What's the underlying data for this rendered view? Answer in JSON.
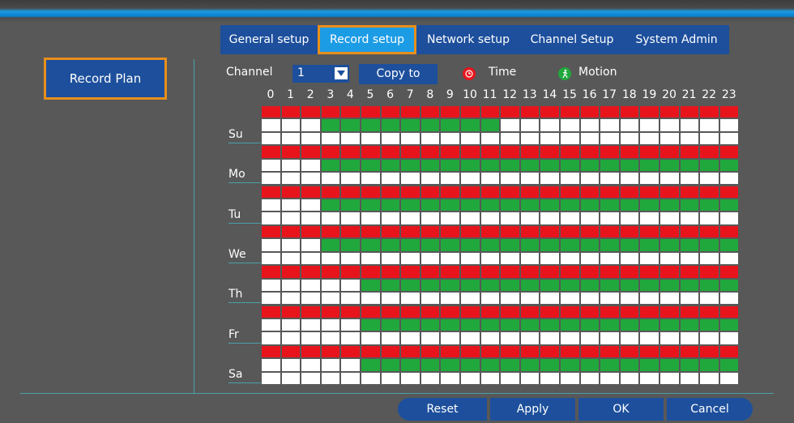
{
  "tabs": [
    {
      "label": "General setup",
      "active": false
    },
    {
      "label": "Record setup",
      "active": true
    },
    {
      "label": "Network setup",
      "active": false
    },
    {
      "label": "Channel Setup",
      "active": false
    },
    {
      "label": "System Admin",
      "active": false
    }
  ],
  "sidebar": {
    "record_plan_label": "Record Plan"
  },
  "toolbar": {
    "channel_label": "Channel",
    "channel_value": "1",
    "copy_label": "Copy to",
    "time_label": "Time",
    "motion_label": "Motion"
  },
  "hours": [
    "0",
    "1",
    "2",
    "3",
    "4",
    "5",
    "6",
    "7",
    "8",
    "9",
    "10",
    "11",
    "12",
    "13",
    "14",
    "15",
    "16",
    "17",
    "18",
    "19",
    "20",
    "21",
    "22",
    "23"
  ],
  "schedule": [
    {
      "day": "Su",
      "time": [
        1,
        1,
        1,
        1,
        1,
        1,
        1,
        1,
        1,
        1,
        1,
        1,
        1,
        1,
        1,
        1,
        1,
        1,
        1,
        1,
        1,
        1,
        1,
        1
      ],
      "motion": [
        0,
        0,
        0,
        1,
        1,
        1,
        1,
        1,
        1,
        1,
        1,
        1,
        0,
        0,
        0,
        0,
        0,
        0,
        0,
        0,
        0,
        0,
        0,
        0
      ]
    },
    {
      "day": "Mo",
      "time": [
        1,
        1,
        1,
        1,
        1,
        1,
        1,
        1,
        1,
        1,
        1,
        1,
        1,
        1,
        1,
        1,
        1,
        1,
        1,
        1,
        1,
        1,
        1,
        1
      ],
      "motion": [
        0,
        0,
        0,
        1,
        1,
        1,
        1,
        1,
        1,
        1,
        1,
        1,
        1,
        1,
        1,
        1,
        1,
        1,
        1,
        1,
        1,
        1,
        1,
        1
      ]
    },
    {
      "day": "Tu",
      "time": [
        1,
        1,
        1,
        1,
        1,
        1,
        1,
        1,
        1,
        1,
        1,
        1,
        1,
        1,
        1,
        1,
        1,
        1,
        1,
        1,
        1,
        1,
        1,
        1
      ],
      "motion": [
        0,
        0,
        0,
        1,
        1,
        1,
        1,
        1,
        1,
        1,
        1,
        1,
        1,
        1,
        1,
        1,
        1,
        1,
        1,
        1,
        1,
        1,
        1,
        1
      ]
    },
    {
      "day": "We",
      "time": [
        1,
        1,
        1,
        1,
        1,
        1,
        1,
        1,
        1,
        1,
        1,
        1,
        1,
        1,
        1,
        1,
        1,
        1,
        1,
        1,
        1,
        1,
        1,
        1
      ],
      "motion": [
        0,
        0,
        0,
        1,
        1,
        1,
        1,
        1,
        1,
        1,
        1,
        1,
        1,
        1,
        1,
        1,
        1,
        1,
        1,
        1,
        1,
        1,
        1,
        1
      ]
    },
    {
      "day": "Th",
      "time": [
        1,
        1,
        1,
        1,
        1,
        1,
        1,
        1,
        1,
        1,
        1,
        1,
        1,
        1,
        1,
        1,
        1,
        1,
        1,
        1,
        1,
        1,
        1,
        1
      ],
      "motion": [
        0,
        0,
        0,
        0,
        0,
        1,
        1,
        1,
        1,
        1,
        1,
        1,
        1,
        1,
        1,
        1,
        1,
        1,
        1,
        1,
        1,
        1,
        1,
        1
      ]
    },
    {
      "day": "Fr",
      "time": [
        1,
        1,
        1,
        1,
        1,
        1,
        1,
        1,
        1,
        1,
        1,
        1,
        1,
        1,
        1,
        1,
        1,
        1,
        1,
        1,
        1,
        1,
        1,
        1
      ],
      "motion": [
        0,
        0,
        0,
        0,
        0,
        1,
        1,
        1,
        1,
        1,
        1,
        1,
        1,
        1,
        1,
        1,
        1,
        1,
        1,
        1,
        1,
        1,
        1,
        1
      ]
    },
    {
      "day": "Sa",
      "time": [
        1,
        1,
        1,
        1,
        1,
        1,
        1,
        1,
        1,
        1,
        1,
        1,
        1,
        1,
        1,
        1,
        1,
        1,
        1,
        1,
        1,
        1,
        1,
        1
      ],
      "motion": [
        0,
        0,
        0,
        0,
        0,
        1,
        1,
        1,
        1,
        1,
        1,
        1,
        1,
        1,
        1,
        1,
        1,
        1,
        1,
        1,
        1,
        1,
        1,
        1
      ]
    }
  ],
  "colors": {
    "time": "#e8141c",
    "motion": "#21a83c",
    "empty": "#ffffff",
    "accent": "#1d4f9c",
    "highlight": "#e88f1b"
  },
  "buttons": {
    "reset": "Reset",
    "apply": "Apply",
    "ok": "OK",
    "cancel": "Cancel"
  }
}
